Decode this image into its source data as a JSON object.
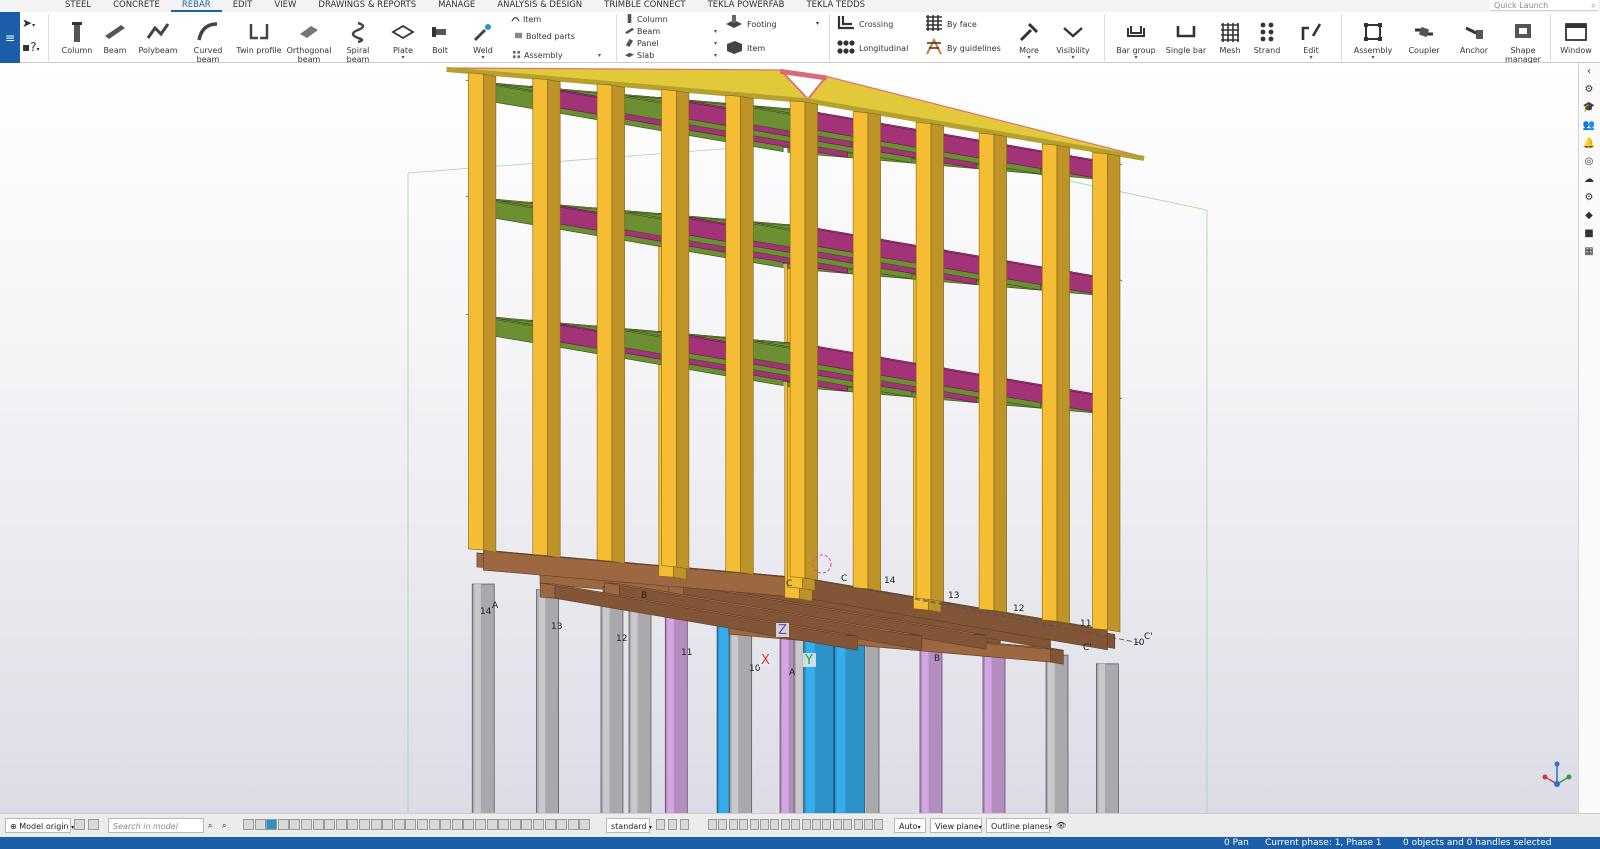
{
  "menu_tabs": [
    {
      "label": "STEEL",
      "active": false
    },
    {
      "label": "CONCRETE",
      "active": false
    },
    {
      "label": "REBAR",
      "active": true
    },
    {
      "label": "EDIT",
      "active": false
    },
    {
      "label": "VIEW",
      "active": false
    },
    {
      "label": "DRAWINGS & REPORTS",
      "active": false
    },
    {
      "label": "MANAGE",
      "active": false
    },
    {
      "label": "ANALYSIS & DESIGN",
      "active": false
    },
    {
      "label": "TRIMBLE CONNECT",
      "active": false
    },
    {
      "label": "TEKLA POWERFAB",
      "active": false
    },
    {
      "label": "TEKLA TEDDS",
      "active": false
    }
  ],
  "quick_launch": {
    "placeholder": "Quick Launch"
  },
  "ribbon": {
    "steel_buttons": [
      "Column",
      "Beam",
      "Polybeam",
      "Curved beam",
      "Twin profile",
      "Orthogonal beam",
      "Spiral beam",
      "Plate",
      "Bolt",
      "Weld"
    ],
    "steel_small": [
      "Item",
      "Bolted parts",
      "Assembly"
    ],
    "concrete_small": [
      "Column",
      "Beam",
      "Panel",
      "Slab"
    ],
    "concrete_big": [
      "Footing",
      "Item"
    ],
    "rebar_small": [
      "Crossing",
      "Longitudinal"
    ],
    "rebar_small2": [
      "By face",
      "By guidelines"
    ],
    "rebar_buttons": [
      "More",
      "Visibility",
      "Bar group",
      "Single bar",
      "Mesh",
      "Strand",
      "Edit"
    ],
    "assembly_buttons": [
      "Assembly",
      "Coupler",
      "Anchor",
      "Shape manager"
    ],
    "window_button": "Window"
  },
  "viewport": {
    "grid_labels": [
      "14",
      "A",
      "13",
      "12",
      "B",
      "11",
      "C",
      "C",
      "14",
      "13",
      "12",
      "11",
      "10",
      "C'",
      "10",
      "A",
      "B",
      "C'"
    ],
    "axis_labels": {
      "x": "X",
      "y": "Y",
      "z": "Z"
    }
  },
  "bottom_bar": {
    "model_origin": "Model origin",
    "search_placeholder": "Search in model",
    "mode": "standard",
    "auto": "Auto",
    "view_plane": "View plane",
    "outline_planes": "Outline planes"
  },
  "status": {
    "pan": "0 Pan",
    "phase": "Current phase: 1, Phase 1",
    "selection": "0 objects and 0 handles selected"
  },
  "colors": {
    "accent": "#1c5fa8",
    "column": "#e8b431",
    "beam_green": "#7fa83d",
    "beam_magenta": "#c03c8c",
    "foundation": "#b8794c",
    "pile_gray": "#a9a9ad",
    "pile_blue": "#2d92c8",
    "pile_purple": "#b48cc0",
    "roof_truss": "#e2c93a",
    "roof_rafter": "#d86a7a"
  }
}
